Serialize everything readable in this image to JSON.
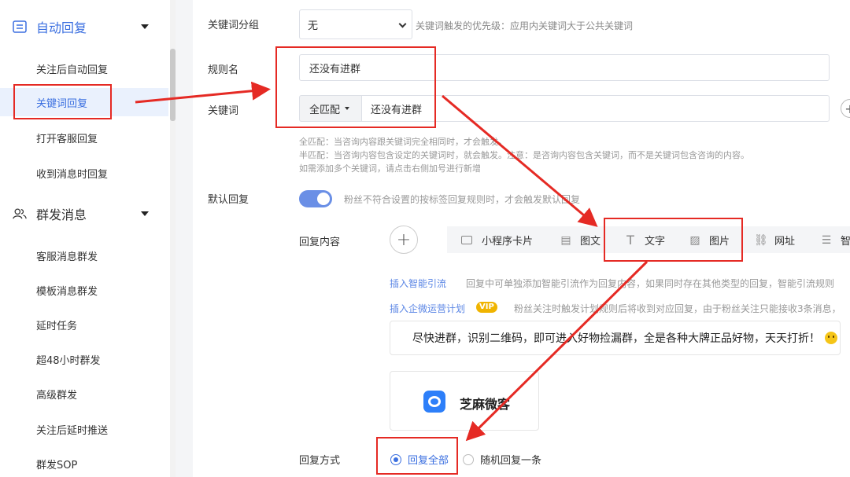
{
  "sidebar": {
    "groups": [
      {
        "label": "自动回复",
        "icon": "list-icon"
      },
      {
        "label": "群发消息",
        "icon": "users-icon"
      }
    ],
    "auto_reply_items": [
      "关注后自动回复",
      "关键词回复",
      "打开客服回复",
      "收到消息时回复"
    ],
    "mass_items": [
      "客服消息群发",
      "模板消息群发",
      "延时任务",
      "超48小时群发",
      "高级群发",
      "关注后延时推送",
      "群发SOP"
    ],
    "active_item": "关键词回复"
  },
  "form": {
    "group_label": "关键词分组",
    "group_value": "无",
    "group_hint": "关键词触发的优先级：应用内关键词大于公共关键词",
    "rule_label": "规则名",
    "rule_value": "还没有进群",
    "keyword_label": "关键词",
    "match_mode": "全匹配",
    "keyword_value": "还没有进群",
    "add_symbol": "+",
    "help_lines": [
      "全匹配：当咨询内容跟关键词完全相同时，才会触发。",
      "半匹配：当咨询内容包含设定的关键词时，就会触发。注意：是咨询内容包含关键词，而不是关键词包含咨询的内容。",
      "如需添加多个关键词，请点击右侧加号进行新增"
    ],
    "default_reply_label": "默认回复",
    "default_reply_hint": "粉丝不符合设置的按标签回复规则时，才会触发默认回复",
    "reply_content_label": "回复内容",
    "reply_types": [
      "小程序卡片",
      "图文",
      "文字",
      "图片",
      "网址",
      "智"
    ],
    "smart_link": "插入智能引流",
    "smart_desc": "回复中可单独添加智能引流作为回复内容，如果同时存在其他类型的回复，智能引流规则",
    "plan_link": "插入企微运营计划",
    "vip_badge": "VIP",
    "plan_desc": "粉丝关注时触发计划规则后将收到对应回复，由于粉丝关注只能接收3条消息，",
    "reply_text": "尽快进群，识别二维码，即可进入好物捡漏群，全是各种大牌正品好物，天天打折！",
    "card_brand": "芝麻微客",
    "reply_mode_label": "回复方式",
    "reply_modes": [
      "回复全部",
      "随机回复一条"
    ],
    "selected_mode": "回复全部"
  },
  "colors": {
    "accent": "#3b6fe0",
    "annotation": "#e52a24",
    "toggle": "#6a8fe6"
  }
}
